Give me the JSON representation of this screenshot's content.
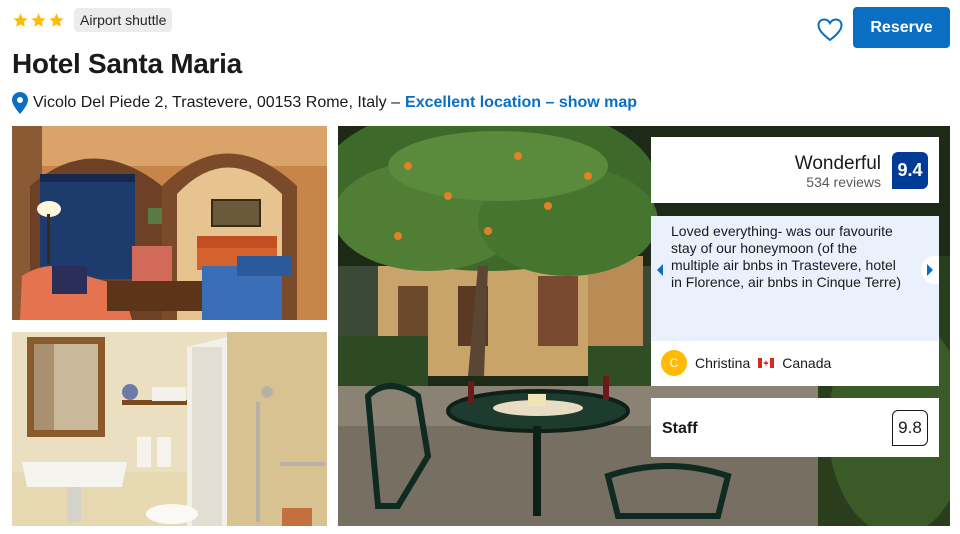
{
  "header": {
    "star_rating": 3,
    "star_color": "#febb02",
    "badge": "Airport shuttle",
    "reserve_label": "Reserve",
    "accent_color": "#0a6fc2"
  },
  "hotel": {
    "name": "Hotel Santa Maria",
    "address": "Vicolo Del Piede 2, Trastevere, 00153 Rome, Italy –",
    "location_link": "Excellent location – show map"
  },
  "rating": {
    "label": "Wonderful",
    "reviews": "534 reviews",
    "score": "9.4",
    "score_color": "#003b95"
  },
  "review": {
    "text": "Loved everything- was our favourite stay of our honeymoon (of the multiple air bnbs in Trastevere, hotel in Florence, air bnbs in Cinque Terre)",
    "reviewer_initial": "C",
    "reviewer_name": "Christina",
    "reviewer_country": "Canada"
  },
  "category": {
    "label": "Staff",
    "score": "9.8"
  },
  "icons": {
    "star": "star-icon",
    "heart": "heart-icon",
    "pin": "map-pin-icon",
    "prev": "chevron-left-icon",
    "next": "chevron-right-icon",
    "flag": "canada-flag-icon"
  }
}
